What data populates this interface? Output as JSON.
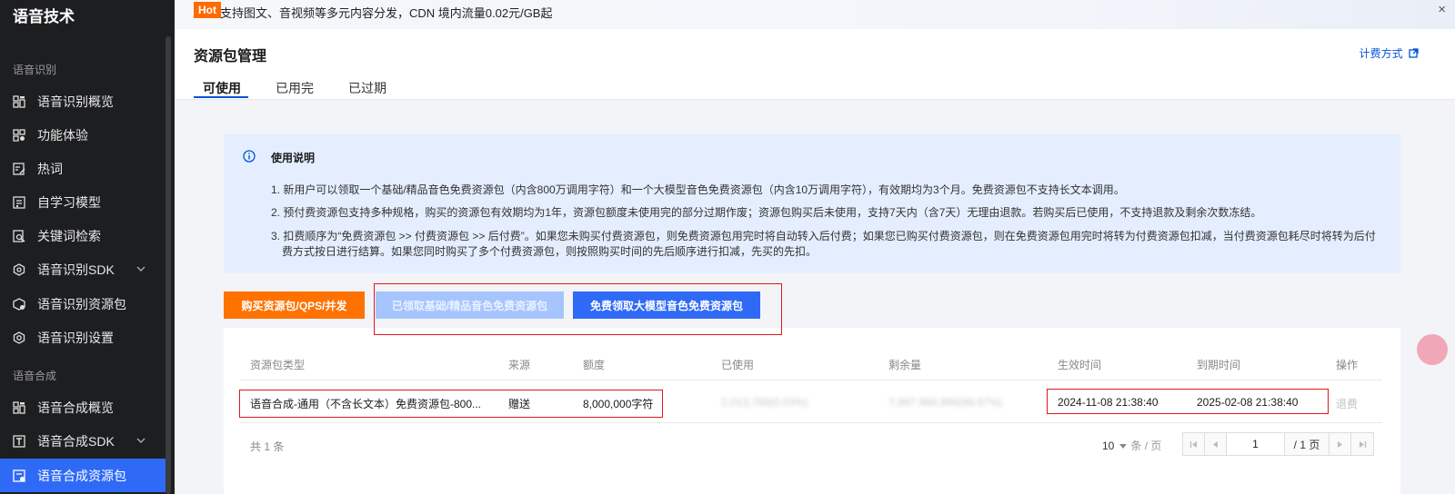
{
  "sidebar": {
    "title": "语音技术",
    "sections": [
      {
        "label": "语音识别",
        "items": [
          {
            "label": "语音识别概览",
            "icon": "grid-icon"
          },
          {
            "label": "功能体验",
            "icon": "puzzle-icon"
          },
          {
            "label": "热词",
            "icon": "edit-list-icon"
          },
          {
            "label": "自学习模型",
            "icon": "document-icon"
          },
          {
            "label": "关键词检索",
            "icon": "search-doc-icon"
          },
          {
            "label": "语音识别SDK",
            "icon": "hexagon-icon",
            "expandable": true
          },
          {
            "label": "语音识别资源包",
            "icon": "package-icon"
          },
          {
            "label": "语音识别设置",
            "icon": "settings-icon"
          }
        ]
      },
      {
        "label": "语音合成",
        "items": [
          {
            "label": "语音合成概览",
            "icon": "grid-icon"
          },
          {
            "label": "语音合成SDK",
            "icon": "text-box-icon",
            "expandable": true
          },
          {
            "label": "语音合成资源包",
            "icon": "package-icon",
            "active": true
          }
        ]
      }
    ]
  },
  "banner": {
    "badge": "Hot",
    "text": "支持图文、音视频等多元内容分发，CDN 境内流量0.02元/GB起",
    "close": "×"
  },
  "header": {
    "title": "资源包管理",
    "pricing_link": "计费方式",
    "tabs": [
      {
        "label": "可使用",
        "active": true
      },
      {
        "label": "已用完"
      },
      {
        "label": "已过期"
      }
    ]
  },
  "notice": {
    "title": "使用说明",
    "lines": [
      "1. 新用户可以领取一个基础/精品音色免费资源包（内含800万调用字符）和一个大模型音色免费资源包（内含10万调用字符），有效期均为3个月。免费资源包不支持长文本调用。",
      "2. 预付费资源包支持多种规格，购买的资源包有效期均为1年，资源包额度未使用完的部分过期作废；资源包购买后未使用，支持7天内（含7天）无理由退款。若购买后已使用，不支持退款及剩余次数冻结。",
      "3. 扣费顺序为“免费资源包 >> 付费资源包 >> 后付费”。如果您未购买付费资源包，则免费资源包用完时将自动转入后付费；如果您已购买付费资源包，则在免费资源包用完时将转为付费资源包扣减，当付费资源包耗尽时将转为后付",
      "费方式按日进行结算。如果您同时购买了多个付费资源包，则按照购买时间的先后顺序进行扣减，先买的先扣。"
    ]
  },
  "buttons": {
    "buy": "购买资源包/QPS/并发",
    "claimed": "已领取基础/精品音色免费资源包",
    "free": "免费领取大模型音色免费资源包"
  },
  "table": {
    "columns": [
      "资源包类型",
      "来源",
      "额度",
      "已使用",
      "剩余量",
      "生效时间",
      "到期时间",
      "操作"
    ],
    "rows": [
      {
        "type": "语音合成-通用（不含长文本）免费资源包-800...",
        "source": "赠送",
        "quota": "8,000,000字符",
        "used": "2,013,789(0.03%)",
        "remaining": "7,997,986,989(99.97%)",
        "start": "2024-11-08 21:38:40",
        "end": "2025-02-08 21:38:40",
        "action": "退费"
      }
    ],
    "total": "共 1 条",
    "page_size": "10",
    "page_size_unit": "条 / 页",
    "current_page": "1",
    "total_pages": "/ 1 页"
  }
}
